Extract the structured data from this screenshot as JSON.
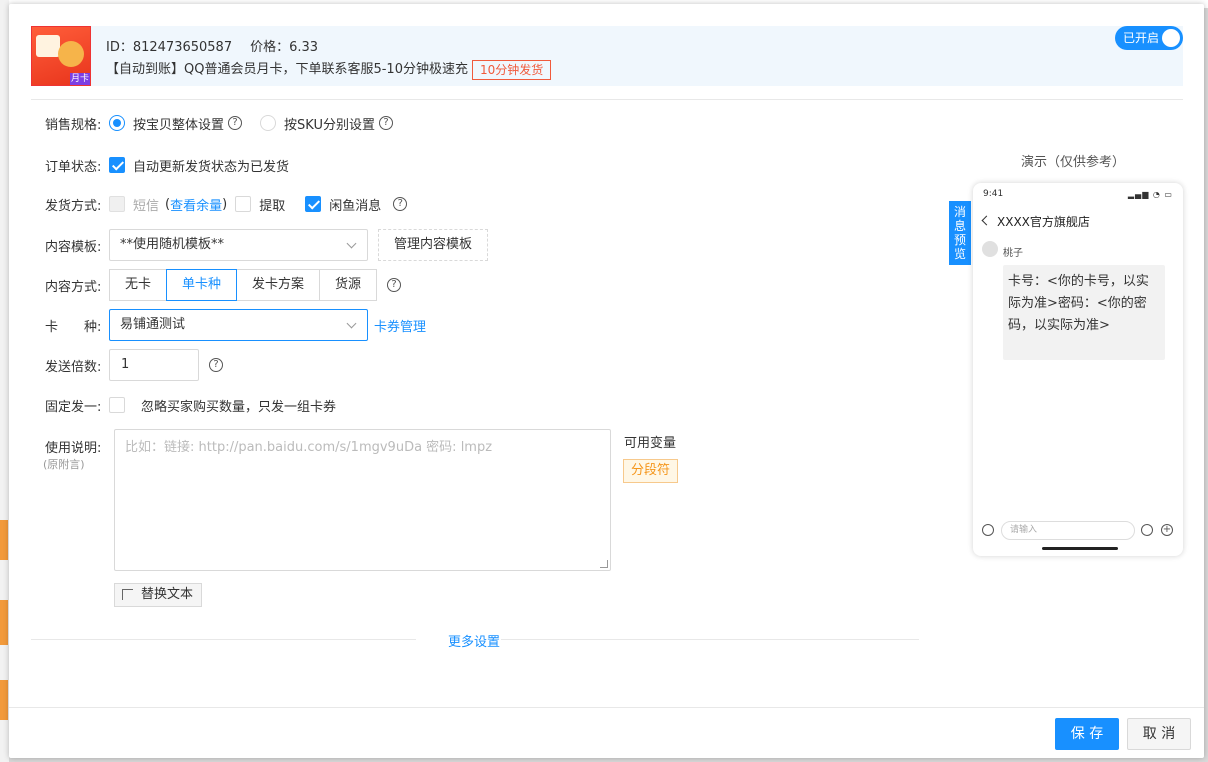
{
  "goods": {
    "id_text": "ID：812473650587",
    "price_text": "价格：6.33",
    "title": "【自动到账】QQ普通会员月卡，下单联系客服5-10分钟极速充",
    "badge": "10分钟发货",
    "thumb_tag": "月卡",
    "toggle_label": "已开启"
  },
  "form": {
    "spec": {
      "label": "销售规格:",
      "opt1": "按宝贝整体设置",
      "opt2": "按SKU分别设置",
      "selected": "opt1"
    },
    "order_status": {
      "label": "订单状态:",
      "checkbox_label": "自动更新发货状态为已发货",
      "checked": true
    },
    "ship": {
      "label": "发货方式:",
      "sms": "短信",
      "sms_link_open": "(",
      "sms_link": "查看余量",
      "sms_link_close": ")",
      "pickup": "提取",
      "xianyu": "闲鱼消息",
      "sms_checked": false,
      "pickup_checked": false,
      "xianyu_checked": true
    },
    "template": {
      "label": "内容模板:",
      "value": "**使用随机模板**",
      "manage_button": "管理内容模板"
    },
    "content_mode": {
      "label": "内容方式:",
      "options": [
        "无卡",
        "单卡种",
        "发卡方案",
        "货源"
      ],
      "selected_index": 1
    },
    "card_type": {
      "label": "卡　　种:",
      "value": "易铺通测试",
      "manage_link": "卡券管理"
    },
    "multiple": {
      "label": "发送倍数:",
      "value": "1"
    },
    "fixed_one": {
      "label": "固定发一:",
      "checkbox_label": "忽略买家购买数量，只发一组卡券",
      "checked": false
    },
    "usage": {
      "label": "使用说明:",
      "sub": "(原附言)",
      "placeholder": "比如：链接: http://pan.baidu.com/s/1mgv9uDa 密码: lmpz",
      "vars_title": "可用变量",
      "var_chip": "分段符",
      "replace_button": "替换文本"
    },
    "more_settings": "更多设置"
  },
  "preview": {
    "demo_title": "演示（仅供参考）",
    "tag": "消息预览",
    "time": "9:41",
    "shop": "XXXX官方旗舰店",
    "sender": "桃子",
    "message": "卡号：<你的卡号，以实际为准>密码：<你的密码，以实际为准>",
    "input_placeholder": "请输入"
  },
  "footer": {
    "save": "保 存",
    "cancel": "取 消"
  },
  "colors": {
    "primary": "#1890ff",
    "badge_red": "#f05a3c",
    "chip_orange": "#f5961c"
  }
}
